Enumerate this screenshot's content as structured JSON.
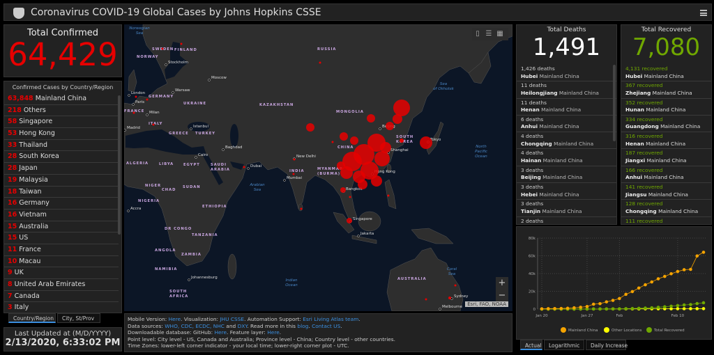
{
  "header": {
    "title": "Coronavirus COVID-19 Global Cases by Johns Hopkins CSSE",
    "logo": "jhu-shield-logo",
    "menu_icon": "hamburger-menu-icon"
  },
  "confirmed": {
    "label": "Total Confirmed",
    "value": "64,429",
    "color": "#e60000"
  },
  "country_list": {
    "title": "Confirmed Cases by Country/Region",
    "items": [
      {
        "count": "63,848",
        "name": "Mainland China"
      },
      {
        "count": "218",
        "name": "Others"
      },
      {
        "count": "58",
        "name": "Singapore"
      },
      {
        "count": "53",
        "name": "Hong Kong"
      },
      {
        "count": "33",
        "name": "Thailand"
      },
      {
        "count": "28",
        "name": "South Korea"
      },
      {
        "count": "28",
        "name": "Japan"
      },
      {
        "count": "19",
        "name": "Malaysia"
      },
      {
        "count": "18",
        "name": "Taiwan"
      },
      {
        "count": "16",
        "name": "Germany"
      },
      {
        "count": "16",
        "name": "Vietnam"
      },
      {
        "count": "15",
        "name": "Australia"
      },
      {
        "count": "15",
        "name": "US"
      },
      {
        "count": "11",
        "name": "France"
      },
      {
        "count": "10",
        "name": "Macau"
      },
      {
        "count": "9",
        "name": "UK"
      },
      {
        "count": "8",
        "name": "United Arab Emirates"
      },
      {
        "count": "7",
        "name": "Canada"
      },
      {
        "count": "3",
        "name": "Italy"
      }
    ]
  },
  "left_tabs": [
    {
      "label": "Country/Region",
      "active": true
    },
    {
      "label": "City, St/Prov",
      "active": false
    }
  ],
  "updated": {
    "label": "Last Updated at (M/D/YYYY)",
    "value": "2/13/2020, 6:33:02 PM"
  },
  "map": {
    "labels": {
      "country": [
        "RUSSIA",
        "SWEDEN",
        "FINLAND",
        "NORWAY",
        "GERMANY",
        "UKRAINE",
        "KAZAKHSTAN",
        "MONGOLIA",
        "CHINA",
        "FRANCE",
        "ITALY",
        "GREECE",
        "TURKEY",
        "LIBYA",
        "EGYPT",
        "SAUDI ARABIA",
        "ALGERIA",
        "INDIA",
        "SOUTH KOREA",
        "NIGER",
        "CHAD",
        "SUDAN",
        "NIGERIA",
        "ETHIOPIA",
        "DR CONGO",
        "TANZANIA",
        "ANGOLA",
        "ZAMBIA",
        "NAMIBIA",
        "SOUTH AFRICA",
        "MYANMAR (BURMA)",
        "AUSTRALIA"
      ],
      "city": [
        "Stockholm",
        "Moscow",
        "London",
        "Paris",
        "Warsaw",
        "Milan",
        "Istanbul",
        "Madrid",
        "Baghdad",
        "Cairo",
        "Dubai",
        "New Delhi",
        "Mumbai",
        "Beijing",
        "Shanghai",
        "Tokyo",
        "Hong Kong",
        "Bangkok",
        "Singapore",
        "Jakarta",
        "Accra",
        "Johannesburg",
        "Sydney",
        "Melbourne"
      ],
      "water": [
        "Norwegian Sea",
        "Sea of Okhotsk",
        "North Pacific Ocean",
        "Arabian Sea",
        "Indian Ocean",
        "Coral Sea"
      ]
    },
    "tools": [
      "bookmark-icon",
      "legend-list-icon",
      "basemap-gallery-icon"
    ],
    "zoom_in": "+",
    "zoom_out": "−",
    "attribution": "Esri, FAO, NOAA",
    "marker_color": "#e60000"
  },
  "info": {
    "l1": [
      "Mobile Version: ",
      "Here",
      ". Visualization: ",
      "JHU CSSE",
      ". Automation Support: ",
      "Esri Living Atlas team",
      "."
    ],
    "l2": [
      "Data sources: ",
      "WHO, CDC, ECDC, NHC",
      " and ",
      "DXY",
      ". Read more in this ",
      "blog",
      ". ",
      "Contact US",
      "."
    ],
    "l3": [
      "Downloadable database: GitHub: ",
      "Here",
      ". Feature layer: ",
      "Here",
      "."
    ],
    "l4": "Point level: City level - US, Canada and Australia; Province level - China; Country level - other countries.",
    "l5": "Time Zones: lower-left corner indicator - your local time; lower-right corner plot - UTC."
  },
  "deaths": {
    "label": "Total Deaths",
    "value": "1,491",
    "color": "#ffffff",
    "items": [
      {
        "count": "1,426 deaths",
        "prov": "Hubei",
        "loc": "Mainland China"
      },
      {
        "count": "11 deaths",
        "prov": "Heilongjiang",
        "loc": "Mainland China"
      },
      {
        "count": "11 deaths",
        "prov": "Henan",
        "loc": "Mainland China"
      },
      {
        "count": "6 deaths",
        "prov": "Anhui",
        "loc": "Mainland China"
      },
      {
        "count": "4 deaths",
        "prov": "Chongqing",
        "loc": "Mainland China"
      },
      {
        "count": "4 deaths",
        "prov": "Hainan",
        "loc": "Mainland China"
      },
      {
        "count": "3 deaths",
        "prov": "Beijing",
        "loc": "Mainland China"
      },
      {
        "count": "3 deaths",
        "prov": "Hebei",
        "loc": "Mainland China"
      },
      {
        "count": "3 deaths",
        "prov": "Tianjin",
        "loc": "Mainland China"
      },
      {
        "count": "2 deaths"
      }
    ]
  },
  "recovered": {
    "label": "Total Recovered",
    "value": "7,080",
    "color": "#70a800",
    "items": [
      {
        "count": "4,131 recovered",
        "prov": "Hubei",
        "loc": "Mainland China"
      },
      {
        "count": "367 recovered",
        "prov": "Zhejiang",
        "loc": "Mainland China"
      },
      {
        "count": "352 recovered",
        "prov": "Hunan",
        "loc": "Mainland China"
      },
      {
        "count": "334 recovered",
        "prov": "Guangdong",
        "loc": "Mainland China"
      },
      {
        "count": "316 recovered",
        "prov": "Henan",
        "loc": "Mainland China"
      },
      {
        "count": "187 recovered",
        "prov": "Jiangxi",
        "loc": "Mainland China"
      },
      {
        "count": "166 recovered",
        "prov": "Anhui",
        "loc": "Mainland China"
      },
      {
        "count": "141 recovered",
        "prov": "Jiangsu",
        "loc": "Mainland China"
      },
      {
        "count": "128 recovered",
        "prov": "Chongqing",
        "loc": "Mainland China"
      },
      {
        "count": "111 recovered"
      }
    ]
  },
  "chart_tabs": [
    {
      "label": "Actual",
      "active": true
    },
    {
      "label": "Logarithmic",
      "active": false
    },
    {
      "label": "Daily Increase",
      "active": false
    }
  ],
  "chart_data": {
    "type": "line",
    "x": [
      "Jan 20",
      "Jan 21",
      "Jan 22",
      "Jan 23",
      "Jan 24",
      "Jan 25",
      "Jan 26",
      "Jan 27",
      "Jan 28",
      "Jan 29",
      "Jan 30",
      "Jan 31",
      "Feb 1",
      "Feb 2",
      "Feb 3",
      "Feb 4",
      "Feb 5",
      "Feb 6",
      "Feb 7",
      "Feb 8",
      "Feb 9",
      "Feb 10",
      "Feb 11",
      "Feb 12",
      "Feb 13",
      "Feb 14"
    ],
    "x_ticks": [
      "Jan 20",
      "Jan 27",
      "Feb",
      "Feb 10"
    ],
    "y_ticks": [
      "0",
      "20k",
      "40k",
      "60k",
      "80k"
    ],
    "ylim": [
      0,
      80000
    ],
    "grid": true,
    "legend_position": "bottom",
    "series": [
      {
        "name": "Mainland China",
        "color": "#f5a300",
        "values": [
          300,
          450,
          550,
          640,
          920,
          1400,
          2060,
          2860,
          5490,
          6070,
          8120,
          9780,
          11870,
          16600,
          19690,
          23680,
          27400,
          30550,
          34080,
          36780,
          39790,
          42310,
          44330,
          44700,
          59830,
          64000
        ]
      },
      {
        "name": "Other Locations",
        "color": "#ffff00",
        "values": [
          5,
          10,
          20,
          30,
          40,
          50,
          60,
          80,
          100,
          110,
          130,
          150,
          170,
          190,
          210,
          230,
          250,
          280,
          300,
          320,
          340,
          370,
          390,
          410,
          430,
          450
        ]
      },
      {
        "name": "Total Recovered",
        "color": "#70a800",
        "values": [
          0,
          10,
          28,
          30,
          36,
          39,
          49,
          58,
          101,
          120,
          135,
          214,
          275,
          463,
          614,
          843,
          1115,
          1476,
          1999,
          2596,
          3217,
          3918,
          4636,
          5082,
          6217,
          7080
        ]
      }
    ]
  }
}
